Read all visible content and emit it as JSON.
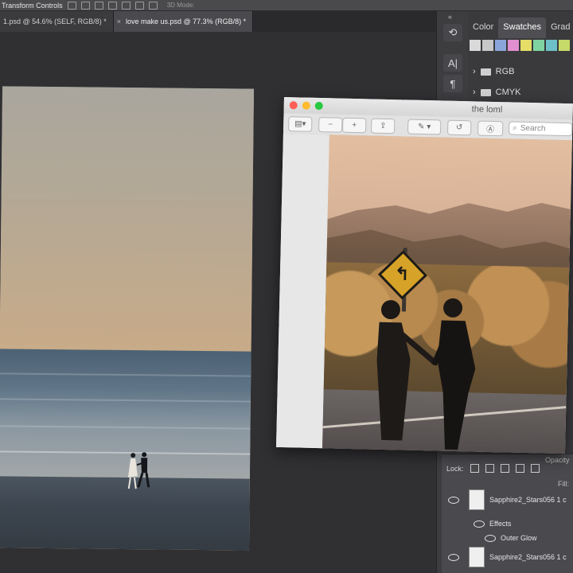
{
  "options_bar": {
    "label": "Transform Controls",
    "mode_label": "3D Mode:"
  },
  "document_tabs": [
    {
      "title": "1.psd @ 54.6% (SELF, RGB/8) *",
      "close": "",
      "active": false
    },
    {
      "title": "love make us.psd @ 77.3% (RGB/8) *",
      "close": "×",
      "active": true
    }
  ],
  "toolbar_collapse": "«",
  "right_panel": {
    "tabs": [
      {
        "label": "Color",
        "active": false
      },
      {
        "label": "Swatches",
        "active": true
      },
      {
        "label": "Grad",
        "active": false
      }
    ],
    "swatch_colors": [
      "#d9d9d9",
      "#c8c8c8",
      "#8aa6d9",
      "#e08fd0",
      "#e6dd66",
      "#7fd3a1",
      "#6ec0c8",
      "#c6da6a"
    ],
    "folders": [
      "RGB",
      "CMYK"
    ]
  },
  "preview_window": {
    "title": "the loml",
    "search_placeholder": "Search"
  },
  "layers_panel": {
    "lock_label": "Lock:",
    "opacity_label": "Opacity",
    "fill_label": "Fill:",
    "layers": [
      {
        "name": "Sapphire2_Stars056 1 c",
        "effects_label": "Effects",
        "effect": "Outer Glow"
      },
      {
        "name": "Sapphire2_Stars056 1 c"
      }
    ]
  },
  "colors": {
    "ps_panel": "#3a3a3d",
    "ps_canvas": "#303033",
    "traffic_red": "#fe5f57",
    "traffic_yellow": "#febc2e",
    "traffic_green": "#28c840"
  }
}
